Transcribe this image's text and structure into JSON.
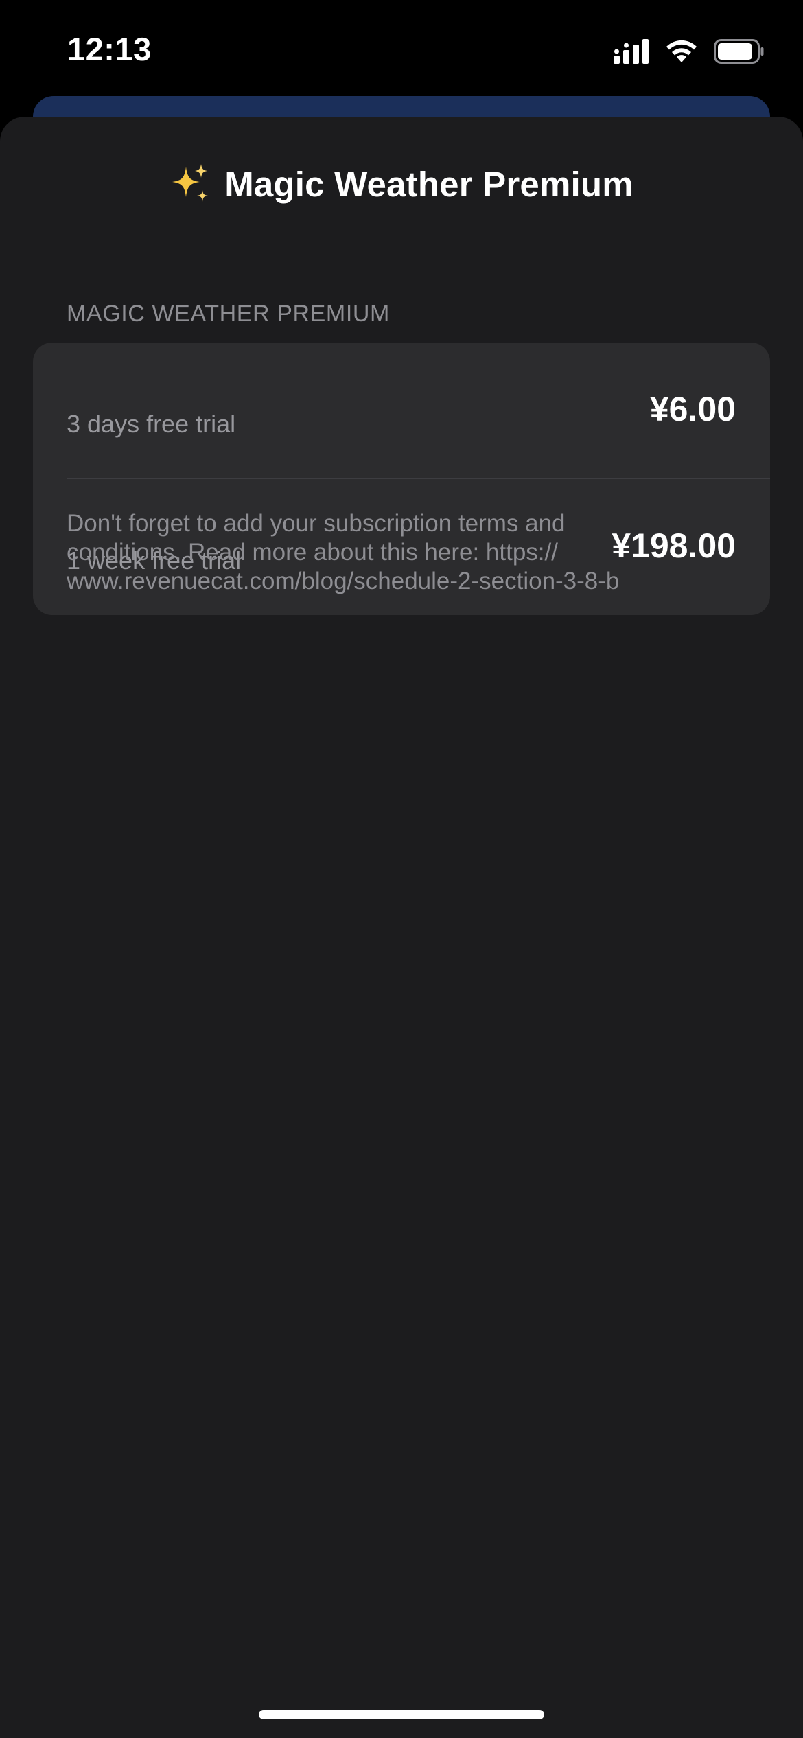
{
  "status_bar": {
    "time": "12:13",
    "icons": [
      "cellular-signal-icon",
      "wifi-icon",
      "battery-icon"
    ]
  },
  "sheet": {
    "title_icon": "sparkles-icon",
    "title": "Magic Weather Premium",
    "section_header": "MAGIC WEATHER PREMIUM",
    "options": [
      {
        "label": "3 days free trial",
        "price": "¥6.00"
      },
      {
        "label": "1 week free trial",
        "price": "¥198.00"
      }
    ],
    "terms": "Don't forget to add your subscription terms and\nconditions. Read more about this here: https://\nwww.revenuecat.com/blog/schedule-2-section-3-8-b"
  },
  "colors": {
    "background": "#000000",
    "sheet": "#1c1c1e",
    "card": "#2c2c2e",
    "secondary_text": "#8e8e93",
    "behind_card": "#1b2f5a",
    "sparkle": "#f5c542"
  }
}
